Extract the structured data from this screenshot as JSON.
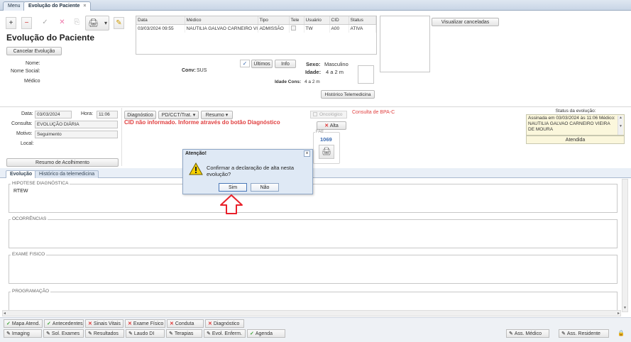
{
  "tabs": [
    {
      "label": "Menu"
    },
    {
      "label": "Evolução do Paciente"
    }
  ],
  "toolbar": {
    "add_icon": "+",
    "remove_icon": "−",
    "check_icon": "✓",
    "cancel_icon": "✕",
    "copy_icon": "⎘",
    "print_icon": "🖨",
    "dropdown_icon": "▾",
    "edit_icon": "✎"
  },
  "header": {
    "title": "Evolução do Paciente",
    "cancel_button": "Cancelar Evolução",
    "view_cancelled_button": "Visualizar canceladas"
  },
  "grid": {
    "columns": [
      "Data",
      "Médico",
      "Tipo",
      "Tele",
      "Usuário",
      "CID",
      "Status"
    ],
    "rows": [
      {
        "data": "03/03/2024 09:55",
        "medico": "NAUTILIA GALVAO CARNEIRO VIEII",
        "tipo": "ADMISSÃO",
        "tele": "",
        "usuario": "TW",
        "cid": "A00",
        "status": "ATIVA"
      }
    ]
  },
  "patient": {
    "nome_label": "Nome:",
    "nome_social_label": "Nome Social:",
    "medico_label": "Médico",
    "conv_label": "Conv:",
    "conv_value": "SUS",
    "ultimos_button": "Últimos",
    "info_button": "Info",
    "sexo_label": "Sexo:",
    "sexo_value": "Masculino",
    "idade_label": "Idade:",
    "idade_value": "4 a 2 m",
    "idade_cons_label": "Idade Cons:",
    "idade_cons_value": "4 a 2 m",
    "historico_button": "Histórico Telemedicina"
  },
  "form": {
    "data_label": "Data:",
    "data_value": "03/03/2024",
    "hora_label": "Hora:",
    "hora_value": "11:06",
    "consulta_label": "Consulta:",
    "consulta_value": "EVOLUÇÃO DIÁRIA",
    "motivo_label": "Motivo:",
    "motivo_value": "Seguimento",
    "local_label": "Local:",
    "resumo_acolhimento_button": "Resumo de Acolhimento"
  },
  "diag": {
    "diagnostico_button": "Diagnóstico",
    "pd_button": "PD/CCT/Trat.",
    "resumo_button": "Resumo",
    "cid_warning": "CID não informado. Informe através do botão Diagnóstico",
    "oncologico_label": "Oncológico",
    "consulta_bpa": "Consulta de BPA-C",
    "alta_button": "Alta",
    "fae_label": "FAE",
    "fae_value": "1069"
  },
  "status_panel": {
    "title": "Status da evolução:",
    "text": "Assinada em 03/03/2024 às 11:06 Médico: NAUTILIA GALVAO CARNEIRO VIEIRA DE MOURA",
    "status": "Atendida"
  },
  "bottom_tabs": [
    {
      "label": "Evolução"
    },
    {
      "label": "Histórico da telemedicina"
    }
  ],
  "sections": [
    {
      "label": "HIPOTESE DIAGNÓSTICA",
      "content": "RTEW"
    },
    {
      "label": "OCORRÊNCIAS",
      "content": ""
    },
    {
      "label": "EXAME FISICO",
      "content": ""
    },
    {
      "label": "PROGRAMAÇÃO",
      "content": ""
    }
  ],
  "bottom_row1": [
    {
      "label": "Mapa Atend.",
      "icon": "check-icon"
    },
    {
      "label": "Antecedentes",
      "icon": "check-icon"
    },
    {
      "label": "Sinais Vitais",
      "icon": "x-icon"
    },
    {
      "label": "Exame Físico",
      "icon": "x-icon"
    },
    {
      "label": "Conduta",
      "icon": "x-icon"
    },
    {
      "label": "Diagnóstico",
      "icon": "x-icon"
    }
  ],
  "bottom_row2": [
    {
      "label": "Imaging",
      "icon": "pencil-icon"
    },
    {
      "label": "Sol. Exames",
      "icon": "pencil-icon"
    },
    {
      "label": "Resultados",
      "icon": "pencil-icon"
    },
    {
      "label": "Laudo DI",
      "icon": "pencil-icon"
    },
    {
      "label": "Terapias",
      "icon": "pencil-icon"
    },
    {
      "label": "Evol. Enferm.",
      "icon": "pencil-icon"
    },
    {
      "label": "Agenda",
      "icon": "check-icon"
    }
  ],
  "bottom_right": {
    "ass_medico": "Ass. Médico",
    "ass_residente": "Ass. Residente"
  },
  "dialog": {
    "title": "Atenção!",
    "message": "Confirmar a declaração de alta nesta evolução?",
    "yes": "Sim",
    "no": "Não"
  },
  "colors": {
    "accent": "#dfe9f5",
    "warning_red": "#e04040",
    "arrow_red": "#e8202a",
    "status_bg": "#fbf7dc"
  }
}
